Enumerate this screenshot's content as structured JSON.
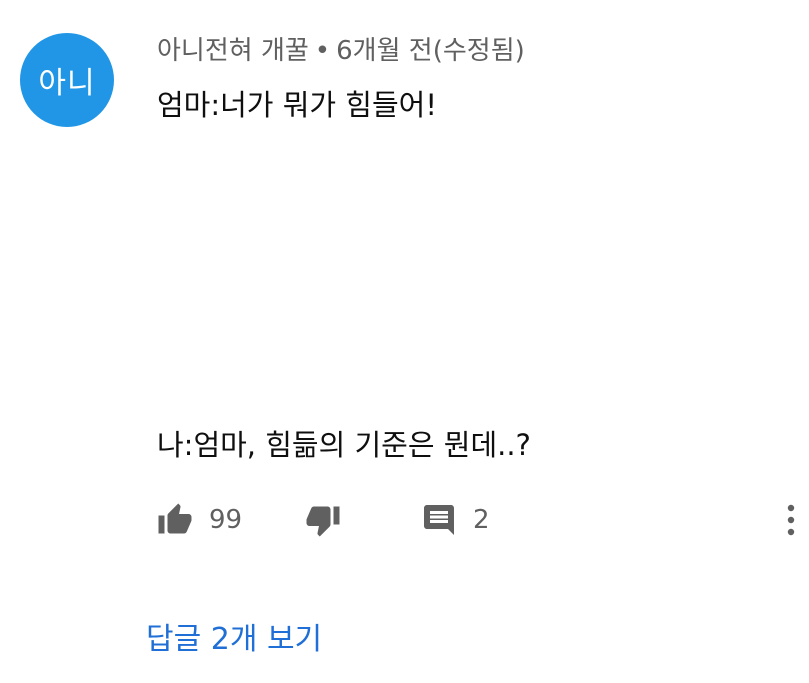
{
  "comment": {
    "avatar_text": "아니",
    "author": "아니전혀 개꿀",
    "separator": "•",
    "time": "6개월 전(수정됨)",
    "lines": [
      "엄마:너가 뭐가 힘들어!",
      "나:엄마, 힘듦의 기준은 뭔데..?"
    ],
    "likes": "99",
    "replies_count": "2",
    "view_replies": "답글 2개 보기"
  },
  "colors": {
    "avatar": "#2196e6",
    "link": "#1f6fd6",
    "meta": "#606060",
    "text": "#0f0f0f"
  },
  "icons": {
    "like": "thumb-up-icon",
    "dislike": "thumb-down-icon",
    "reply": "comment-icon",
    "more": "more-vert-icon"
  }
}
